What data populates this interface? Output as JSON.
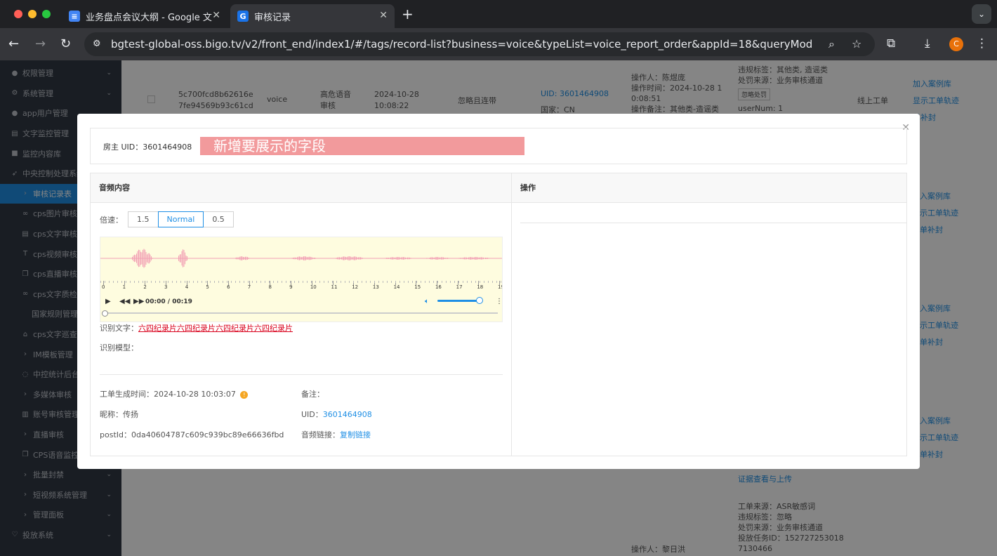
{
  "browser": {
    "tabs": [
      {
        "title": "业务盘点会议大纲 - Google 文",
        "favicon": "docs-icon",
        "favicon_color": "#4285f4"
      },
      {
        "title": "审核记录",
        "favicon": "G",
        "favicon_color": "#1a73e8"
      }
    ],
    "url": "bgtest-global-oss.bigo.tv/v2/front_end/index1/#/tags/record-list?business=voice&typeList=voice_report_order&appId=18&queryMode=normal&start=1...",
    "profile_initial": "C"
  },
  "sidebar": {
    "items": [
      {
        "label": "权限管理",
        "icon": "user-icon",
        "arrow": "⌄"
      },
      {
        "label": "系统管理",
        "icon": "gear-icon",
        "arrow": "⌄"
      },
      {
        "label": "app用户管理",
        "icon": "users-icon",
        "arrow": ""
      },
      {
        "label": "文字监控管理",
        "icon": "doc-icon",
        "arrow": ""
      },
      {
        "label": "监控内容库",
        "icon": "square-icon",
        "arrow": ""
      },
      {
        "label": "中央控制处理系统",
        "icon": "rocket-icon",
        "arrow": ""
      },
      {
        "label": "审核记录表",
        "icon": "chevron-icon",
        "arrow": ""
      },
      {
        "label": "cps图片审核",
        "icon": "link-icon",
        "arrow": ""
      },
      {
        "label": "cps文字审核",
        "icon": "file-icon",
        "arrow": ""
      },
      {
        "label": "cps视频审核",
        "icon": "text-icon",
        "arrow": ""
      },
      {
        "label": "cps直播审核",
        "icon": "copy-icon",
        "arrow": ""
      },
      {
        "label": "cps文字质检",
        "icon": "link-icon",
        "arrow": "⌄"
      },
      {
        "label": "国家规则管理",
        "icon": "",
        "arrow": ""
      },
      {
        "label": "cps文字巡查",
        "icon": "home-icon",
        "arrow": ""
      },
      {
        "label": "IM模板管理",
        "icon": "chevron-icon",
        "arrow": ""
      },
      {
        "label": "中控统计后台",
        "icon": "chat-icon",
        "arrow": ""
      },
      {
        "label": "多媒体审核",
        "icon": "chevron-icon",
        "arrow": ""
      },
      {
        "label": "账号审核管理",
        "icon": "bank-icon",
        "arrow": ""
      },
      {
        "label": "直播审核",
        "icon": "chevron-icon",
        "arrow": ""
      },
      {
        "label": "CPS语音监控",
        "icon": "copy-icon",
        "arrow": ""
      },
      {
        "label": "批量封禁",
        "icon": "chevron-icon",
        "arrow": "⌄"
      },
      {
        "label": "短视频系统管理",
        "icon": "chevron-icon",
        "arrow": "⌄"
      },
      {
        "label": "管理面板",
        "icon": "chevron-icon",
        "arrow": "⌄"
      },
      {
        "label": "投放系统",
        "icon": "heart-icon",
        "arrow": "⌄"
      }
    ],
    "active_index": 6
  },
  "background_row": {
    "id_line1": "5c700fcd8b62616e",
    "id_line2": "7fe94569b93c61cd",
    "business": "voice",
    "type_line1": "高危语音",
    "type_line2": "审核",
    "time_line1": "2024-10-28",
    "time_line2": "10:08:22",
    "result": "忽略且连带",
    "uid": "UID: 3601464908",
    "country": "国家：CN",
    "operator": "操作人：陈煜庞",
    "op_time1": "操作时间：2024-10-28 1",
    "op_time2": "0:08:51",
    "op_note": "操作备注：其他类-造谣类",
    "violation": "违规标签：其他类, 造谣类",
    "source": "处罚来源：业务审核通道",
    "ignore_btn": "忽略处罚",
    "usernum": "userNum: 1",
    "channel": "线上工单",
    "actions": [
      "加入案例库",
      "显示工单轨迹",
      "单补封"
    ],
    "actions_cut": [
      "入案例库",
      "示工单轨迹",
      "单补封"
    ],
    "evidence": "证据查看与上传",
    "source2": "工单来源：ASR敏感词",
    "violation2": "违规标签：忽略",
    "punish2": "处罚来源：业务审核通道",
    "task_id1": "投放任务ID：152727253018",
    "task_id2": "7130466",
    "operator2": "操作人：黎日洪",
    "watermark": "陈传扬"
  },
  "modal": {
    "owner_label": "房主 UID：",
    "owner_uid": "3601464908",
    "highlight_text": "新增要展示的字段",
    "audio_header": "音频内容",
    "ops_header": "操作",
    "speed_label": "倍速：",
    "speeds": [
      "1.5",
      "Normal",
      "0.5"
    ],
    "selected_speed": "Normal",
    "time_current": "00:00",
    "time_sep": "/",
    "time_total": "00:19",
    "timeline_ticks": [
      "0",
      "1",
      "2",
      "3",
      "4",
      "5",
      "6",
      "7",
      "8",
      "9",
      "10",
      "11",
      "12",
      "13",
      "14",
      "15",
      "16",
      "17",
      "18",
      "19"
    ],
    "recognized_label": "识别文字：",
    "recognized_text": "六四纪录片六四纪录片六四纪录片六四纪录片",
    "model_label": "识别模型：",
    "created_label": "工单生成时间：",
    "created_value": "2024-10-28 10:03:07",
    "nickname_label": "昵称：",
    "nickname_value": "传扬",
    "postid_label": "postId：",
    "postid_value": "0da40604787c609c939bc89e66636fbd",
    "remark_label": "备注：",
    "uid_label": "UID：",
    "uid_value": "3601464908",
    "audio_link_label": "音频链接：",
    "audio_link_value": "复制链接",
    "colors": {
      "accent": "#1f8fe5",
      "highlight": "#f29a9c",
      "waveform": "#f2a0b4",
      "player_bg": "#fefcdf"
    }
  }
}
